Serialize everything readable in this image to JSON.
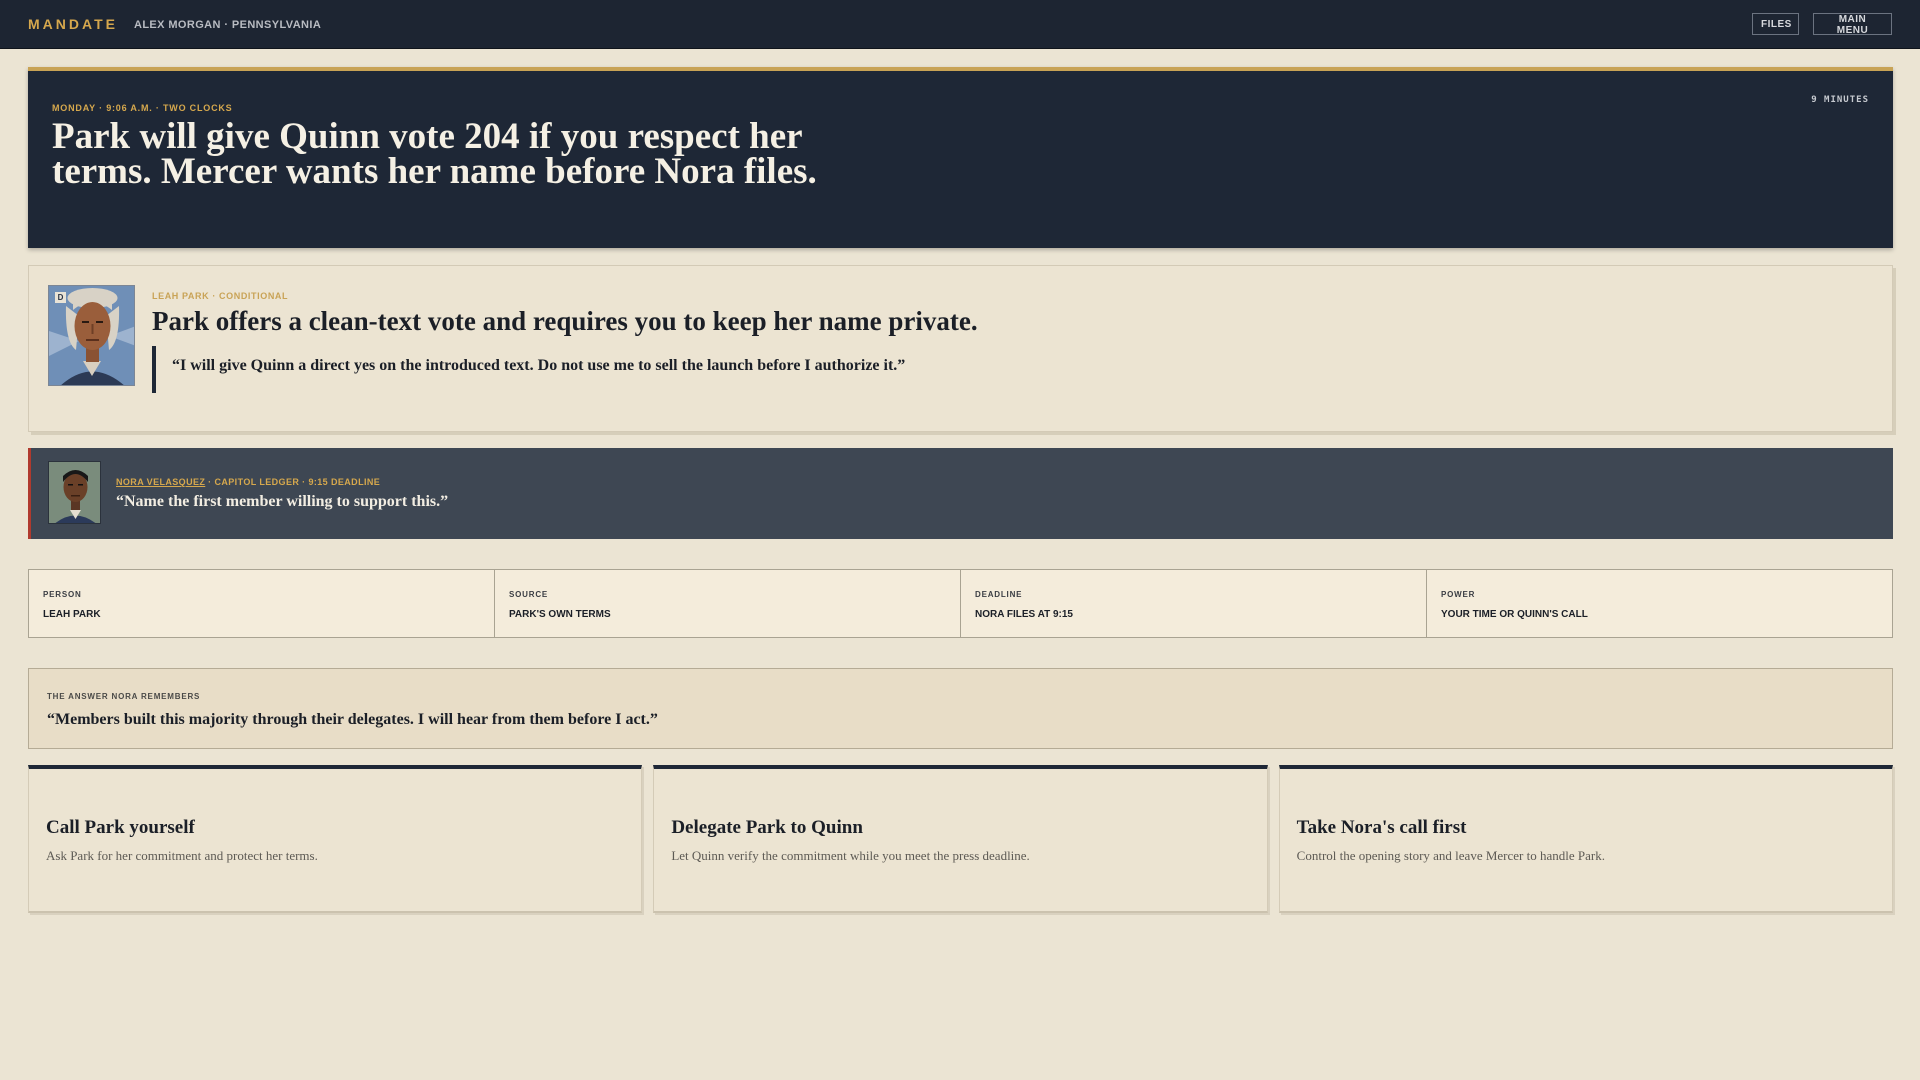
{
  "header": {
    "brand": "MANDATE",
    "player": "ALEX MORGAN · PENNSYLVANIA",
    "files_label": "FILES",
    "menu_label": "MAIN MENU"
  },
  "hero": {
    "kicker": "MONDAY · 9:06 A.M. · TWO CLOCKS",
    "timer": "9 MINUTES",
    "title": "Park will give Quinn vote 204 if you respect her terms. Mercer wants her name before Nora files."
  },
  "leah": {
    "party_tag": "D",
    "kicker": "LEAH PARK · CONDITIONAL",
    "headline": "Park offers a clean-text vote and requires you to keep her name private.",
    "quote": "“I will give Quinn a direct yes on the introduced text. Do not use me to sell the launch before I authorize it.”"
  },
  "nora": {
    "name": "NORA VELASQUEZ",
    "meta": " · CAPITOL LEDGER · 9:15 DEADLINE",
    "quote": "“Name the first member willing to support this.”"
  },
  "facts": [
    {
      "label": "PERSON",
      "value": "LEAH PARK"
    },
    {
      "label": "SOURCE",
      "value": "PARK'S OWN TERMS"
    },
    {
      "label": "DEADLINE",
      "value": "NORA FILES AT 9:15"
    },
    {
      "label": "POWER",
      "value": "YOUR TIME OR QUINN'S CALL"
    }
  ],
  "answer": {
    "label": "THE ANSWER NORA REMEMBERS",
    "quote": "“Members built this majority through their delegates. I will hear from them before I act.”"
  },
  "choices": [
    {
      "title": "Call Park yourself",
      "desc": "Ask Park for her commitment and protect her terms."
    },
    {
      "title": "Delegate Park to Quinn",
      "desc": "Let Quinn verify the commitment while you meet the press deadline."
    },
    {
      "title": "Take Nora's call first",
      "desc": "Control the opening story and leave Mercer to handle Park."
    }
  ],
  "colors": {
    "navy": "#1e2736",
    "gold": "#d6a84d",
    "parchment": "#ebe4d3",
    "slate": "#3e4753",
    "alert_red": "#b03a2e"
  }
}
